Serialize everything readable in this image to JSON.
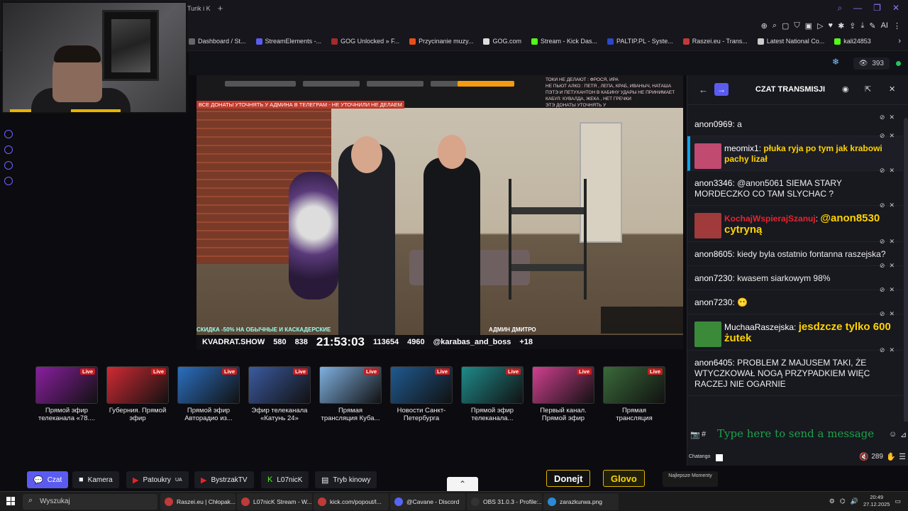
{
  "browser": {
    "tab_title": "Turik i K",
    "bookmarks": [
      {
        "label": "Dashboard / St...",
        "color": "#666666"
      },
      {
        "label": "StreamElements -...",
        "color": "#5b5bf0"
      },
      {
        "label": "GOG Unlocked » F...",
        "color": "#a32b2b"
      },
      {
        "label": "Przycinanie muzy...",
        "color": "#e84f18"
      },
      {
        "label": "GOG.com",
        "color": "#dddddd"
      },
      {
        "label": "Stream - Kick Das...",
        "color": "#53fc18"
      },
      {
        "label": "PALTIP.PL - Syste...",
        "color": "#2a48c8"
      },
      {
        "label": "Raszei.eu - Trans...",
        "color": "#c03a3a"
      },
      {
        "label": "Latest National Co...",
        "color": "#cccccc"
      },
      {
        "label": "kali24853",
        "color": "#53fc18"
      }
    ]
  },
  "stream_header": {
    "viewers": "393"
  },
  "video": {
    "banner": "ВСЕ ДОНАТЫ УТОЧНЯТЬ У АДМИНА В ТЕЛЕГРАМ - НЕ УТОЧНИЛИ НЕ ДЕЛАЕМ",
    "top_right": "ТОКИ НЕ ДЕЛАЮТ : ФРОСЯ, ИРА\nНЕ ПЬЮТ АЛКО : ПЕТЯ , ЛЕПА, КРАБ, ИВАНЫЧ, НАТАША\nПЭТЭ И ПЕТУХАНТОН В КАБИНУ УДАРЫ НЕ ПРИНИМАЕТ\nКАБУЛ: КУВАЛДА, ЖЕКА , НЕТ ГРЕЧКИ\nЭТЭ ДОНАТЫ УТОЧНЯТЬ У",
    "promo": "СКИДКА -50% НА ОБЫЧНЫЕ И КАСКАДЕРСКИЕ",
    "admin": "АДМИН ДМИТРО",
    "bottom": {
      "site": "KVADRAT.SHOW",
      "users": "580",
      "likes": "838",
      "time": "21:53:03",
      "views": "113654",
      "yt": "4960",
      "handle": "@karabas_and_boss",
      "age": "+18"
    }
  },
  "recommended": [
    {
      "title": "Прямой эфир телеканала «78....",
      "thumb": "#8a1fa0",
      "live": "Live"
    },
    {
      "title": "Губерния. Прямой эфир",
      "thumb": "#d12a34",
      "live": "Live"
    },
    {
      "title": "Прямой эфир Авторадио из...",
      "thumb": "#2b6fc0",
      "live": "Live"
    },
    {
      "title": "Эфир телеканала «Катунь 24»",
      "thumb": "#3b5aa0",
      "live": "Live"
    },
    {
      "title": "Прямая трансляция Куба...",
      "thumb": "#7fb0e0",
      "live": "Live"
    },
    {
      "title": "Новости Санкт-Петербурга",
      "thumb": "#1f5a90",
      "live": "Live"
    },
    {
      "title": "Прямой эфир телеканала...",
      "thumb": "#1f8a8a",
      "live": "Live"
    },
    {
      "title": "Первый канал. Прямой эфир",
      "thumb": "#d04090",
      "live": "Live"
    },
    {
      "title": "Прямая трансляция",
      "thumb": "#3a6a3a",
      "live": "Live"
    }
  ],
  "controls": {
    "chat": "Czat",
    "camera": "Kamera",
    "patoukry": "Patoukry",
    "patoukry_tag": "UA",
    "bystrzak": "BystrzakTV",
    "l07nick": "L07nicK",
    "cinema": "Tryb kinowy",
    "donate": "Donejt",
    "glovo": "Glovo",
    "najlepsze": "Najlepsze Momenty"
  },
  "chat": {
    "title": "CZAT TRANSMISJI",
    "messages": [
      {
        "user": "anon0969",
        "text": "a"
      },
      {
        "user": "meomix1",
        "text": "płuka ryja po tym jak krabowi pachy lizał",
        "avatar": "#c04a70"
      },
      {
        "user": "anon3346",
        "text": "@anon5061 SIEMA STARY MORDECZKO CO TAM SLYCHAC ?"
      },
      {
        "user": "KochajWspierajSzanuj",
        "text": "@anon8530 cytryną",
        "avatar": "#a13a3a"
      },
      {
        "user": "anon8605",
        "text": "kiedy byla ostatnio fontanna raszejska?"
      },
      {
        "user": "anon7230",
        "text": "kwasem siarkowym 98%"
      },
      {
        "user": "anon7230",
        "text": "😶"
      },
      {
        "user": "MuchaaRaszejska",
        "text": "jesdzcze tylko 600 żutek",
        "avatar": "#3a8a3a"
      },
      {
        "user": "anon6405",
        "text": "PROBLEM Z MAJUSEM TAKI, ŻE WTYCZKOWAŁ NOGĄ PRZYPADKIEM WIĘC RACZEJ NIE OGARNIE"
      }
    ],
    "input_placeholder": "Type here to send a message",
    "footer_label": "Chatango",
    "footer_count": "289"
  },
  "taskbar": {
    "search": "Wyszukaj",
    "tasks": [
      {
        "label": "Raszei.eu | Chłopak...",
        "color": "#c03a3a"
      },
      {
        "label": "L07nicK Stream - W...",
        "color": "#c03a3a"
      },
      {
        "label": "kick.com/popout/l...",
        "color": "#c03a3a"
      },
      {
        "label": "@Cavane - Discord",
        "color": "#5865f2"
      },
      {
        "label": "OBS 31.0.3 - Profile:...",
        "color": "#333333"
      },
      {
        "label": "zarazkurwa.png",
        "color": "#2a8ad8"
      }
    ],
    "time": "20:49",
    "date": "27.12.2025"
  }
}
